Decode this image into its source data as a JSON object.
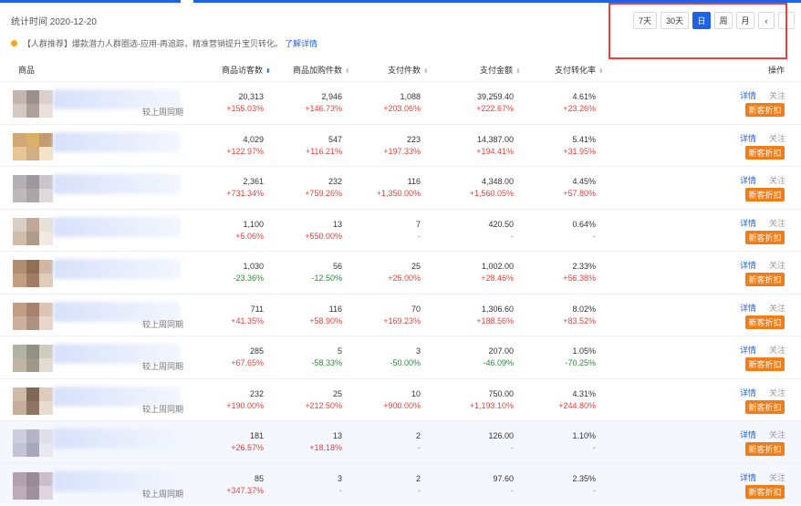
{
  "header": {
    "stat_time": "统计时间 2020-12-20",
    "periods": [
      "7天",
      "30天",
      "日",
      "周",
      "月"
    ],
    "active_period": "日",
    "prev_label": "‹",
    "next_label": "›"
  },
  "notice": {
    "text": "【人群推荐】爆款潜力人群圈选-应用-再追踪，精准营销提升宝贝转化。",
    "link": "了解详情"
  },
  "table": {
    "columns": [
      "商品",
      "商品访客数",
      "商品加购件数",
      "支付件数",
      "支付金额",
      "支付转化率",
      "操作"
    ],
    "compare_label": "较上周同期",
    "actions": {
      "detail": "详情",
      "follow": "关注",
      "coupon": "新客折扣"
    },
    "rows": [
      {
        "visitors": "20,313",
        "visitors_chg": "+155.03%",
        "carts": "2,946",
        "carts_chg": "+146.73%",
        "pay_items": "1,088",
        "pay_items_chg": "+203.06%",
        "pay_amount": "39,259.40",
        "pay_amount_chg": "+222.67%",
        "conv": "4.61%",
        "conv_chg": "+23.26%",
        "show_compare": true
      },
      {
        "visitors": "4,029",
        "visitors_chg": "+122.97%",
        "carts": "547",
        "carts_chg": "+116.21%",
        "pay_items": "223",
        "pay_items_chg": "+197.33%",
        "pay_amount": "14,387.00",
        "pay_amount_chg": "+194.41%",
        "conv": "5.41%",
        "conv_chg": "+31.95%",
        "show_compare": false
      },
      {
        "visitors": "2,361",
        "visitors_chg": "+731.34%",
        "carts": "232",
        "carts_chg": "+759.26%",
        "pay_items": "116",
        "pay_items_chg": "+1,350.00%",
        "pay_amount": "4,348.00",
        "pay_amount_chg": "+1,560.05%",
        "conv": "4.45%",
        "conv_chg": "+57.80%",
        "show_compare": false
      },
      {
        "visitors": "1,100",
        "visitors_chg": "+5.06%",
        "carts": "13",
        "carts_chg": "+550.00%",
        "pay_items": "7",
        "pay_items_chg": "-",
        "pay_amount": "420.50",
        "pay_amount_chg": "-",
        "conv": "0.64%",
        "conv_chg": "-",
        "show_compare": false
      },
      {
        "visitors": "1,030",
        "visitors_chg": "-23.36%",
        "carts": "56",
        "carts_chg": "-12.50%",
        "pay_items": "25",
        "pay_items_chg": "+25.00%",
        "pay_amount": "1,002.00",
        "pay_amount_chg": "+28.46%",
        "conv": "2.33%",
        "conv_chg": "+56.38%",
        "show_compare": false
      },
      {
        "visitors": "711",
        "visitors_chg": "+41.35%",
        "carts": "116",
        "carts_chg": "+58.90%",
        "pay_items": "70",
        "pay_items_chg": "+169.23%",
        "pay_amount": "1,306.60",
        "pay_amount_chg": "+188.56%",
        "conv": "8.02%",
        "conv_chg": "+83.52%",
        "show_compare": true
      },
      {
        "visitors": "285",
        "visitors_chg": "+67.65%",
        "carts": "5",
        "carts_chg": "-58.33%",
        "pay_items": "3",
        "pay_items_chg": "-50.00%",
        "pay_amount": "207.00",
        "pay_amount_chg": "-46.09%",
        "conv": "1.05%",
        "conv_chg": "-70.25%",
        "show_compare": true
      },
      {
        "visitors": "232",
        "visitors_chg": "+190.00%",
        "carts": "25",
        "carts_chg": "+212.50%",
        "pay_items": "10",
        "pay_items_chg": "+900.00%",
        "pay_amount": "750.00",
        "pay_amount_chg": "+1,193.10%",
        "conv": "4.31%",
        "conv_chg": "+244.80%",
        "show_compare": true
      },
      {
        "visitors": "181",
        "visitors_chg": "+26.57%",
        "carts": "13",
        "carts_chg": "+18.18%",
        "pay_items": "2",
        "pay_items_chg": "-",
        "pay_amount": "126.00",
        "pay_amount_chg": "-",
        "conv": "1.10%",
        "conv_chg": "-",
        "show_compare": false
      },
      {
        "visitors": "85",
        "visitors_chg": "+347.37%",
        "carts": "3",
        "carts_chg": "-",
        "pay_items": "2",
        "pay_items_chg": "-",
        "pay_amount": "97.60",
        "pay_amount_chg": "-",
        "conv": "2.35%",
        "conv_chg": "-",
        "show_compare": true
      }
    ]
  },
  "colors": {
    "accent": "#2062e6",
    "increase": "#e8413c",
    "decrease": "#2a8a3a",
    "coupon": "#f07d1a",
    "highlight_box": "#e8413c"
  }
}
